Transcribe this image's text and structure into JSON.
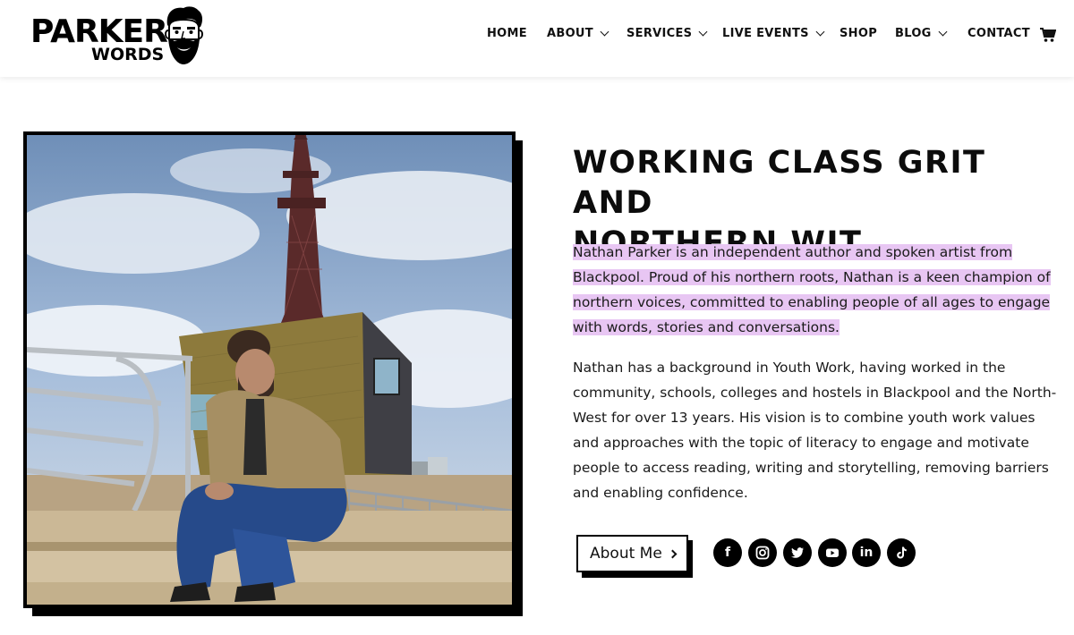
{
  "logo": {
    "line1": "PARKER",
    "line2": "WORDS",
    "icon": "bearded-face-icon"
  },
  "nav": {
    "items": [
      {
        "label": "HOME",
        "dropdown": false
      },
      {
        "label": "ABOUT",
        "dropdown": true
      },
      {
        "label": "SERVICES",
        "dropdown": true
      },
      {
        "label": "LIVE EVENTS",
        "dropdown": true
      },
      {
        "label": "SHOP",
        "dropdown": false
      },
      {
        "label": "BLOG",
        "dropdown": true
      },
      {
        "label": "CONTACT",
        "dropdown": false
      }
    ],
    "cart_icon": "cart-icon"
  },
  "hero": {
    "headline_line1": "WORKING CLASS GRIT AND",
    "headline_line2": "NORTHERN WIT.",
    "paragraph1": "Nathan Parker is an independent author and spoken artist from Blackpool. Proud of his northern roots, Nathan is a keen champion of northern voices, committed to enabling people of all ages to engage with words, stories and conversations.",
    "paragraph2": "Nathan has a background in Youth Work, having worked in the community, schools, colleges and hostels in Blackpool and the North-West for over 13 years. His vision is to combine youth work values and approaches with the topic of literacy to engage and motivate people to access reading, writing and storytelling, removing barriers and enabling confidence.",
    "button_label": "About Me",
    "highlight_color": "#e8c6f3"
  },
  "social": [
    {
      "name": "facebook-icon",
      "glyph": "f"
    },
    {
      "name": "instagram-icon",
      "glyph": ""
    },
    {
      "name": "twitter-icon",
      "glyph": ""
    },
    {
      "name": "youtube-icon",
      "glyph": ""
    },
    {
      "name": "linkedin-icon",
      "glyph": "in"
    },
    {
      "name": "tiktok-icon",
      "glyph": ""
    }
  ]
}
